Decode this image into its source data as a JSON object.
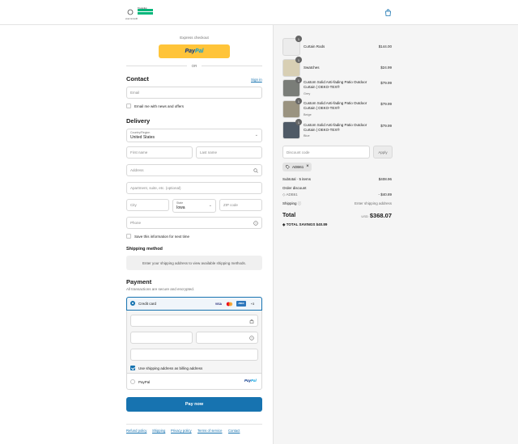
{
  "header": {
    "brand": "ever.smooth",
    "badge": "Trustpilot"
  },
  "express": {
    "label": "Express checkout",
    "paypal_a": "Pay",
    "paypal_b": "Pal",
    "or": "OR"
  },
  "contact": {
    "title": "Contact",
    "signin": "Sign in",
    "email_placeholder": "Email",
    "news_label": "Email me with news and offers"
  },
  "delivery": {
    "title": "Delivery",
    "country_label": "Country/Region",
    "country_value": "United States",
    "first_name": "First name",
    "last_name": "Last name",
    "address": "Address",
    "apartment": "Apartment, suite, etc. (optional)",
    "city": "City",
    "state_label": "State",
    "state_value": "Iowa",
    "zip": "ZIP code",
    "phone": "Phone",
    "save_info": "Save this information for next time"
  },
  "shipping": {
    "title": "Shipping method",
    "notice": "Enter your shipping address to view available shipping methods."
  },
  "payment": {
    "title": "Payment",
    "subtitle": "All transactions are secure and encrypted.",
    "credit_card": "Credit card",
    "cards": [
      "VISA",
      "MC",
      "AMEX"
    ],
    "more": "+3",
    "use_shipping": "Use shipping address as billing address",
    "paypal": "PayPal",
    "paypal_logo_a": "Pay",
    "paypal_logo_b": "Pal",
    "pay_now": "Pay now"
  },
  "footer": {
    "links": [
      "Refund policy",
      "Shipping",
      "Privacy policy",
      "Terms of service",
      "Contact"
    ]
  },
  "summary": {
    "items": [
      {
        "name": "Curtain Rods",
        "variant": "",
        "price": "$144.00",
        "qty": "1"
      },
      {
        "name": "Swatches",
        "variant": "",
        "price": "$24.99",
        "qty": "1"
      },
      {
        "name": "Custom Solid Anti-fading Patio Outdoor Curtain | OEKO-TEX®",
        "variant": "Grey",
        "price": "$79.99",
        "qty": "1"
      },
      {
        "name": "Custom Solid Anti-fading Patio Outdoor Curtain | OEKO-TEX®",
        "variant": "Beige",
        "price": "$79.99",
        "qty": "1"
      },
      {
        "name": "Custom Solid Anti-fading Patio Outdoor Curtain | OEKO-TEX®",
        "variant": "Blue",
        "price": "$79.99",
        "qty": "1"
      }
    ],
    "discount_placeholder": "Discount code",
    "apply": "Apply",
    "code": "ADB61",
    "subtotal_label": "Subtotal · 5 items",
    "subtotal": "$408.96",
    "order_discount": "Order discount",
    "discount_code": "ADB61",
    "discount_amount": "- $40.89",
    "shipping_label": "Shipping",
    "shipping_value": "Enter shipping address",
    "total_label": "Total",
    "currency": "USD",
    "total": "$368.07",
    "savings_label": "TOTAL SAVINGS",
    "savings": "$40.89"
  }
}
